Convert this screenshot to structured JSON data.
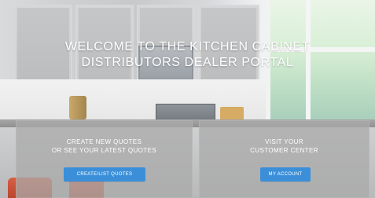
{
  "hero": {
    "title_line1": "WELCOME TO THE KITCHEN CABINET",
    "title_line2": "DISTRIBUTORS DEALER PORTAL"
  },
  "panels": {
    "left": {
      "line1": "CREATE NEW QUOTES",
      "line2": "OR SEE YOUR LATEST QUOTES",
      "button_label": "CREATE/LIST QUOTES"
    },
    "right": {
      "line1": "VISIT YOUR",
      "line2": "CUSTOMER CENTER",
      "button_label": "MY ACCOUNT"
    }
  },
  "colors": {
    "button_blue": "#3b8fd8",
    "panel_overlay": "rgba(170,170,170,0.75)"
  }
}
